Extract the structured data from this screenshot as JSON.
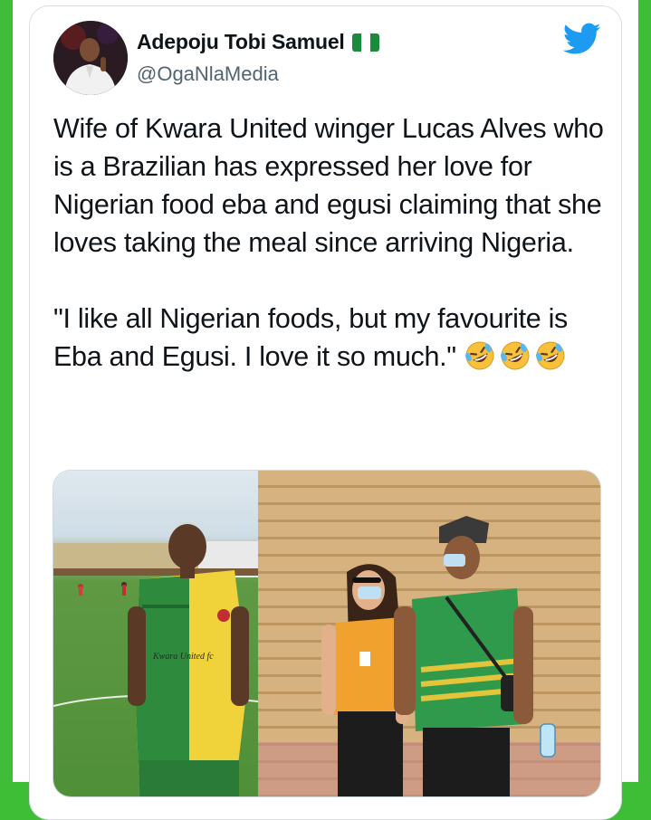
{
  "tweet": {
    "display_name": "Adepoju Tobi Samuel",
    "handle": "@OgaNlaMedia",
    "paragraph1": "Wife of Kwara United winger Lucas Alves who is a Brazilian has expressed her love for Nigerian food eba and egusi claiming that she loves taking the meal since arriving Nigeria.",
    "paragraph2": "\"I like all Nigerian foods, but my favourite is Eba and Egusi. I love it so much.\"",
    "emojis": [
      "rolling-on-floor-laughing-icon",
      "rolling-on-floor-laughing-icon",
      "rolling-on-floor-laughing-icon"
    ],
    "jersey_text": "Kwara United fc"
  },
  "colors": {
    "background_green": "#3dbe36",
    "twitter_blue": "#1d9bf0",
    "flag_green": "#1a8a3b"
  },
  "icons": {
    "brand": "twitter-bird-icon",
    "verified_flag": "nigeria-flag-icon"
  }
}
